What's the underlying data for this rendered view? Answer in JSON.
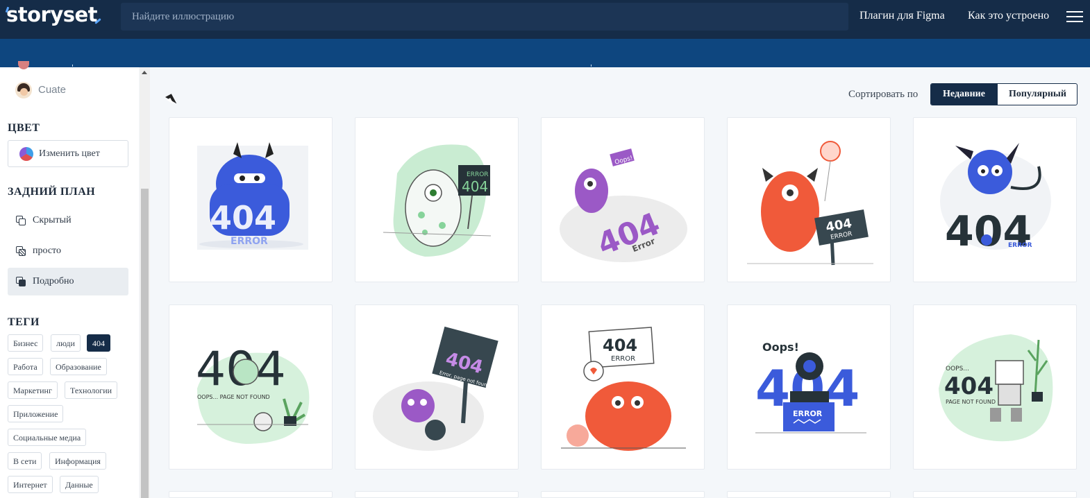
{
  "header": {
    "logo": "storyset",
    "search_placeholder": "Найдите иллюстрацию",
    "nav": [
      "Плагин для Figma",
      "Как это устроено"
    ],
    "menu_icon": "hamburger-icon"
  },
  "sidebar": {
    "style_item": "Cuate",
    "color_title": "ЦВЕТ",
    "color_button": "Изменить цвет",
    "background_title": "ЗАДНИЙ ПЛАН",
    "background_options": [
      "Скрытый",
      "просто",
      "Подробно"
    ],
    "background_selected": "Подробно",
    "tags_title": "ТЕГИ",
    "tags": [
      "Бизнес",
      "люди",
      "404",
      "Работа",
      "Образование",
      "Маркетинг",
      "Технологии",
      "Приложение",
      "Социальные медиа",
      "В сети",
      "Информация",
      "Интернет",
      "Данные"
    ],
    "tag_selected": "404"
  },
  "sort": {
    "label": "Сортировать по",
    "options": [
      "Недавние",
      "Популярный"
    ],
    "selected": "Недавние"
  },
  "illustrations": [
    {
      "accent": "#3b5bdb",
      "text_404": "404",
      "caption": "ERROR"
    },
    {
      "accent": "#86d39a",
      "text_404": "404",
      "caption": "ERROR"
    },
    {
      "accent": "#9b59c6",
      "text_404": "404",
      "caption": "Error",
      "bubble": "Oops!"
    },
    {
      "accent": "#f05a3a",
      "text_404": "404",
      "caption": "ERROR"
    },
    {
      "accent": "#3b5bdb",
      "text_404": "404",
      "caption": "ERROR"
    },
    {
      "accent": "#86d39a",
      "text_404": "404",
      "caption": "OOPS... PAGE NOT FOUND"
    },
    {
      "accent": "#9b59c6",
      "text_404": "404",
      "caption": "Error, page not found"
    },
    {
      "accent": "#f05a3a",
      "text_404": "404",
      "caption": "ERROR"
    },
    {
      "accent": "#3b5bdb",
      "text_404": "404",
      "caption": "ERROR",
      "bubble": "Oops!"
    },
    {
      "accent": "#86d39a",
      "text_404": "404",
      "caption": "PAGE NOT FOUND",
      "bubble": "OOPS..."
    }
  ]
}
